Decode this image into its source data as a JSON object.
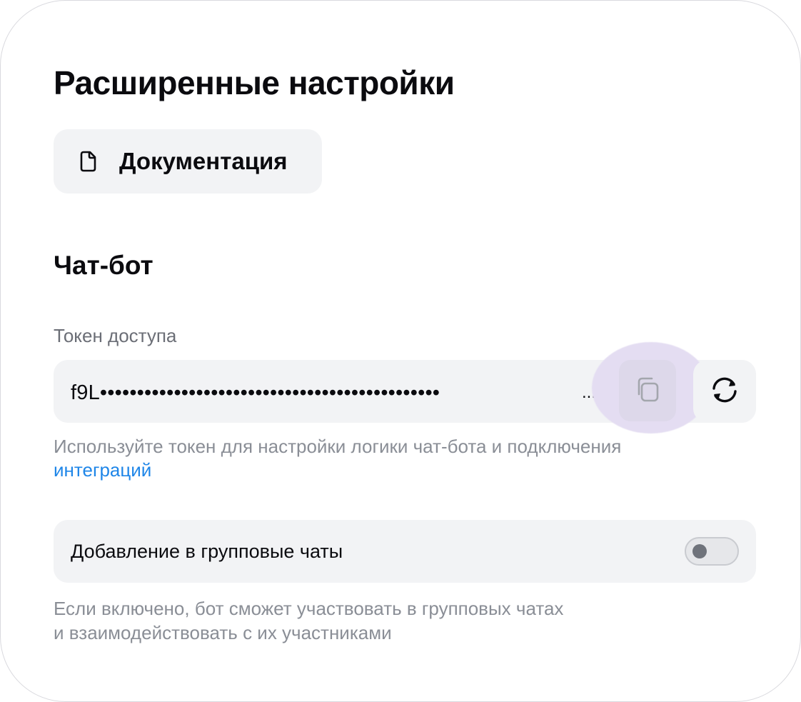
{
  "page": {
    "title": "Расширенные настройки"
  },
  "documentation": {
    "icon": "document-icon",
    "label": "Документация"
  },
  "chatbot": {
    "section_title": "Чат-бот",
    "token": {
      "label": "Токен доступа",
      "value": "f9L••••••••••••••••••••••••••••••••••••••••••••••",
      "ellipsis": "...",
      "copy_icon": "copy-icon",
      "refresh_icon": "refresh-icon"
    },
    "token_hint": {
      "text": "Используйте токен для настройки логики чат-бота и подключения",
      "link": "интеграций"
    },
    "group_chats": {
      "label": "Добавление в групповые чаты",
      "enabled": false,
      "hint_line1": "Если включено, бот сможет участвовать в групповых чатах",
      "hint_line2": "и взаимодействовать с их участниками"
    }
  },
  "colors": {
    "link": "#1f86e8",
    "surface": "#f2f3f5",
    "copy_highlight": "#e4ddf2",
    "muted_text": "#8a8e96"
  }
}
